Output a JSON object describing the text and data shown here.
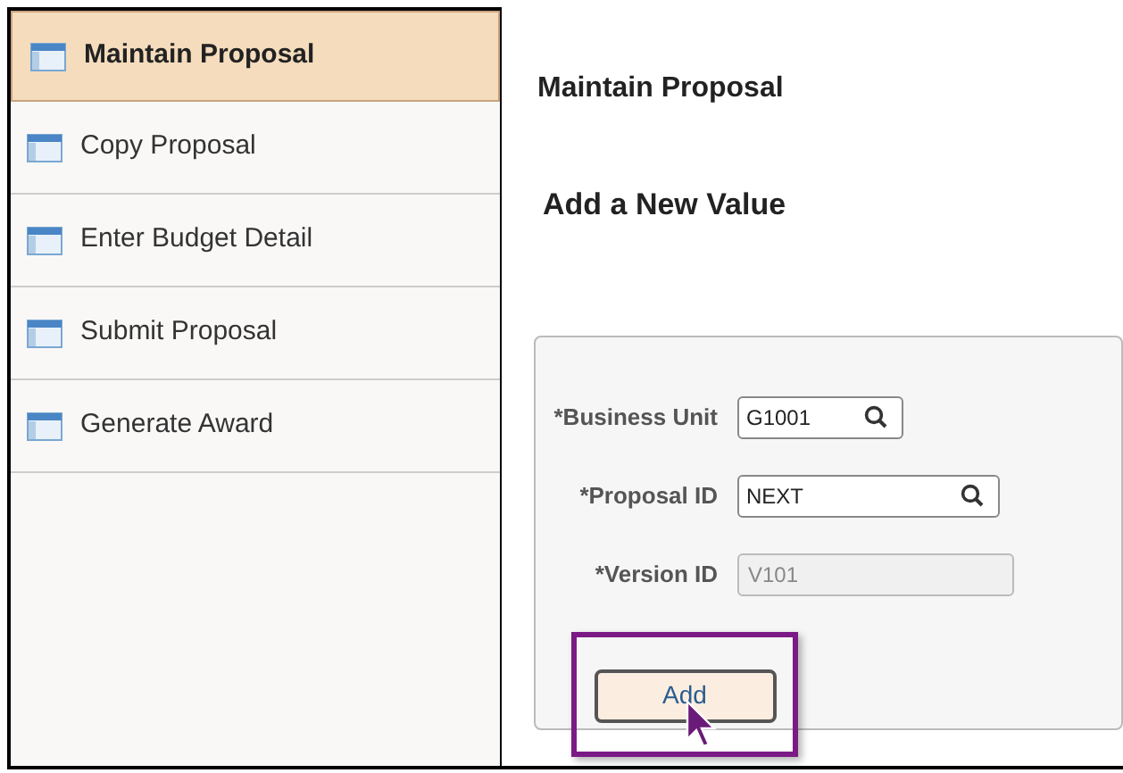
{
  "sidebar": {
    "items": [
      {
        "label": "Maintain Proposal",
        "selected": true
      },
      {
        "label": "Copy Proposal",
        "selected": false
      },
      {
        "label": "Enter Budget Detail",
        "selected": false
      },
      {
        "label": "Submit Proposal",
        "selected": false
      },
      {
        "label": "Generate Award",
        "selected": false
      }
    ]
  },
  "page": {
    "title": "Maintain Proposal",
    "subtitle": "Add a New Value"
  },
  "form": {
    "fields": [
      {
        "label": "*Business Unit",
        "value": "G1001",
        "kind": "search"
      },
      {
        "label": "*Proposal ID",
        "value": "NEXT",
        "kind": "search"
      },
      {
        "label": "*Version ID",
        "value": "V101",
        "kind": "disabled"
      }
    ],
    "button": {
      "label": "Add",
      "highlighted": true
    }
  }
}
